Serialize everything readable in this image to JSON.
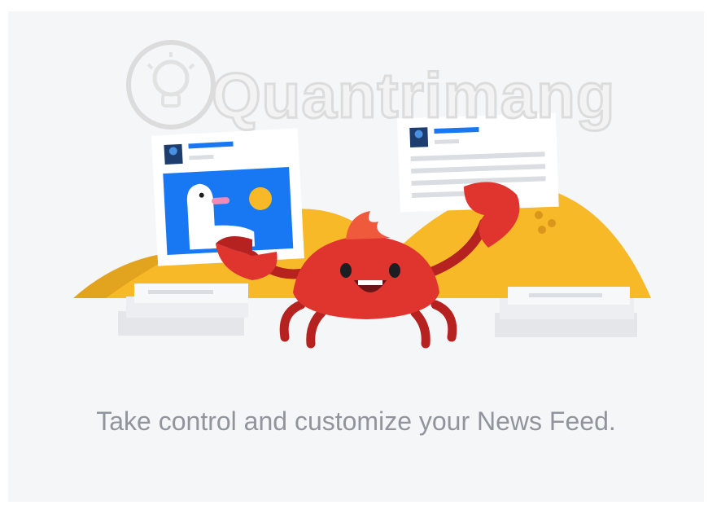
{
  "card": {
    "caption": "Take control and customize your News Feed."
  },
  "watermark": {
    "text": "Quantrimang",
    "icon": "lightbulb-icon"
  },
  "illustration": {
    "subject": "crab-mascot",
    "colors": {
      "background": "#f5f6f7",
      "sand": "#f7b928",
      "sand_dark": "#e2a31f",
      "crab": "#e0342f",
      "crab_dark": "#b5221f",
      "facebook_blue": "#1877f2",
      "caption_gray": "#90949c"
    }
  }
}
